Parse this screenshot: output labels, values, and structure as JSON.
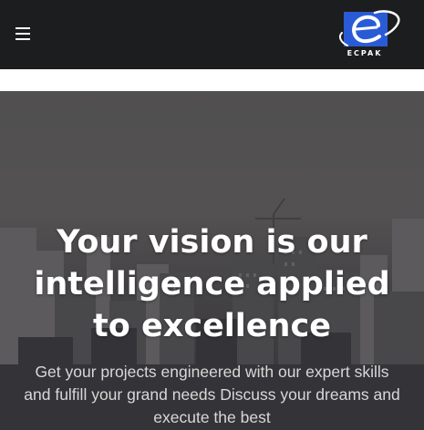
{
  "header": {
    "menu_icon": "hamburger-menu-icon",
    "logo": {
      "text": "ECPAK",
      "accent": "#2a5bd7"
    }
  },
  "hero": {
    "title": "Your vision is our intelligence applied to excellence",
    "subtitle": "Get your projects engineered with our expert skills and fulfill your grand needs Discuss your dreams and execute the best"
  },
  "colors": {
    "topbar": "#1c1d1f",
    "hero_text": "#ffffff",
    "subtitle_text": "#d8d8d8"
  }
}
